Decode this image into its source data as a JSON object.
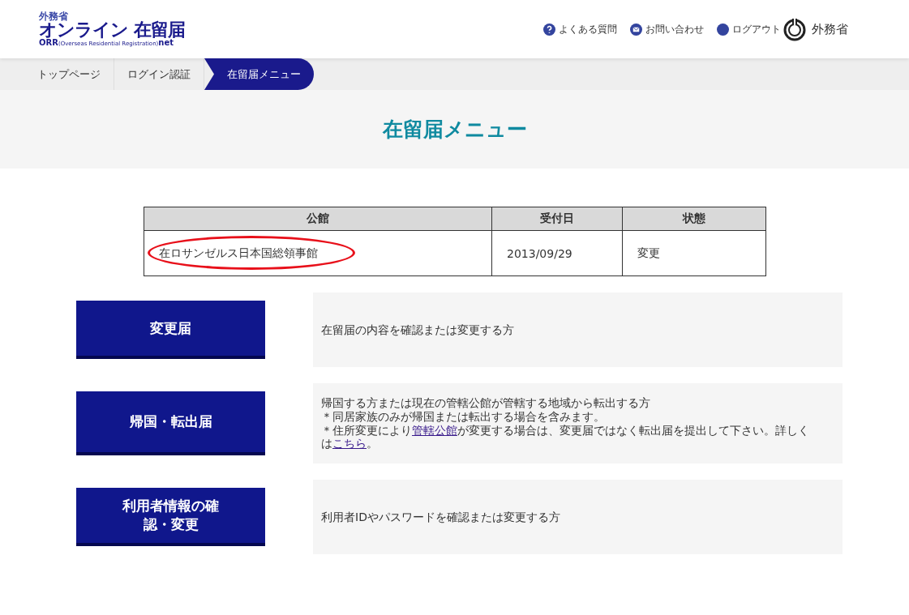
{
  "logo": {
    "ministry": "外務省",
    "name": "オンライン 在留届",
    "subtitle_left": "ORR",
    "subtitle_mid": "(Overseas Residential Registration)",
    "subtitle_right": "net"
  },
  "header_links": [
    {
      "label": "よくある質問",
      "kind": "question"
    },
    {
      "label": "お問い合わせ",
      "kind": "mail"
    },
    {
      "label": "ログアウト",
      "kind": "dot"
    }
  ],
  "ministry_mark": {
    "label": "外務省"
  },
  "breadcrumb": [
    {
      "label": "トップページ",
      "selected": false
    },
    {
      "label": "ログイン認証",
      "selected": false
    },
    {
      "label": "在留届メニュー",
      "selected": true
    }
  ],
  "page_title": "在留届メニュー",
  "table": {
    "columns": [
      "公館",
      "受付日",
      "状態"
    ],
    "rows": [
      {
        "cells": [
          "在ロサンゼルス日本国総領事館",
          "2013/09/29",
          "変更"
        ],
        "circled": true
      }
    ]
  },
  "menu": [
    {
      "button": "変更届",
      "lines": [
        [
          {
            "text": "在留届の内容を確認または変更する方"
          }
        ]
      ]
    },
    {
      "button": "帰国・転出届",
      "lines": [
        [
          {
            "text": "帰国する方または現在の管轄公館が管轄する地域から転出する方"
          }
        ],
        [
          {
            "text": "＊同居家族のみが帰国または転出する場合を含みます。"
          }
        ],
        [
          {
            "text": "＊住所変更により"
          },
          {
            "text": "管轄公館",
            "link": true
          },
          {
            "text": "が変更する場合は、変更届ではなく転出届を提出して下さい。詳しくは"
          },
          {
            "text": "こちら",
            "link": true
          },
          {
            "text": "。"
          }
        ]
      ]
    },
    {
      "button": "利用者情報の確認・変更",
      "lines": [
        [
          {
            "text": "利用者IDやパスワードを確認または変更する方"
          }
        ]
      ]
    }
  ]
}
